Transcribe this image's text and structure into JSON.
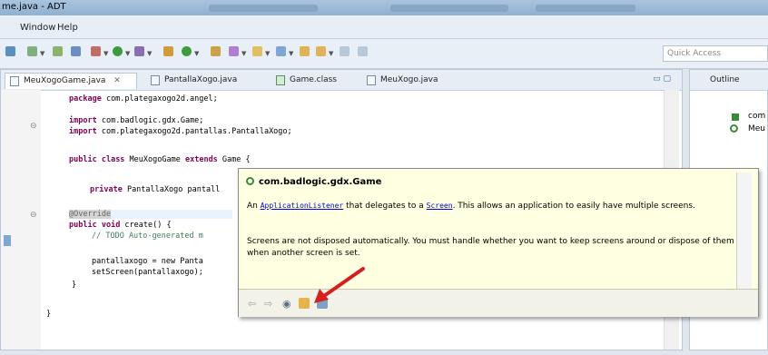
{
  "window": {
    "title": "me.java - ADT"
  },
  "menu": {
    "items": [
      "Window",
      "Help"
    ]
  },
  "toolbar": {
    "quick_access_placeholder": "Quick Access"
  },
  "editor": {
    "tabs": [
      {
        "label": "MeuXogoGame.java",
        "close": "✕"
      },
      {
        "label": "PantallaXogo.java"
      },
      {
        "label": "Game.class"
      },
      {
        "label": "MeuXogo.java"
      }
    ],
    "window_controls": "▭  ▢",
    "code": {
      "l1_kw": "package",
      "l1_rest": " com.plategaxogo2d.angel;",
      "l2_kw": "import",
      "l2_rest": " com.badlogic.gdx.Game;",
      "l3_kw": "import",
      "l3_rest": " com.plategaxogo2d.pantallas.PantallaXogo;",
      "l4_kw1": "public",
      "l4_kw2": " class",
      "l4_name": " MeuXogoGame",
      "l4_kw3": " extends",
      "l4_rest": " Game {",
      "l5_kw": "private",
      "l5_rest": " PantallaXogo pantall",
      "l6_ann": "@Override",
      "l7_kw1": "public",
      "l7_kw2": " void",
      "l7_rest": " create() {",
      "l8_cm": "// TODO Auto-generated m",
      "l9": "pantallaxogo = new Panta",
      "l10": "setScreen(pantallaxogo);",
      "l11": "}",
      "l12": "}"
    }
  },
  "outline": {
    "tab_label": "Outline",
    "items": [
      "com",
      "Meu"
    ]
  },
  "tooltip": {
    "title": "com.badlogic.gdx.Game",
    "p1_a": "An ",
    "p1_link1": "ApplicationListener",
    "p1_b": " that delegates to a ",
    "p1_link2": "Screen",
    "p1_c": ". This allows an application to easily have multiple screens.",
    "p2": "Screens are not disposed automatically. You must handle whether you want to keep screens around or dispose of them when another screen is set."
  },
  "colors": {
    "accent": "#d62020",
    "tooltip_bg": "#ffffe1",
    "keyword": "#7f0055"
  },
  "icons": [
    "back-icon",
    "forward-icon",
    "open-external-icon",
    "open-declaration-icon",
    "javadoc-view-icon",
    "pointer-arrow"
  ]
}
